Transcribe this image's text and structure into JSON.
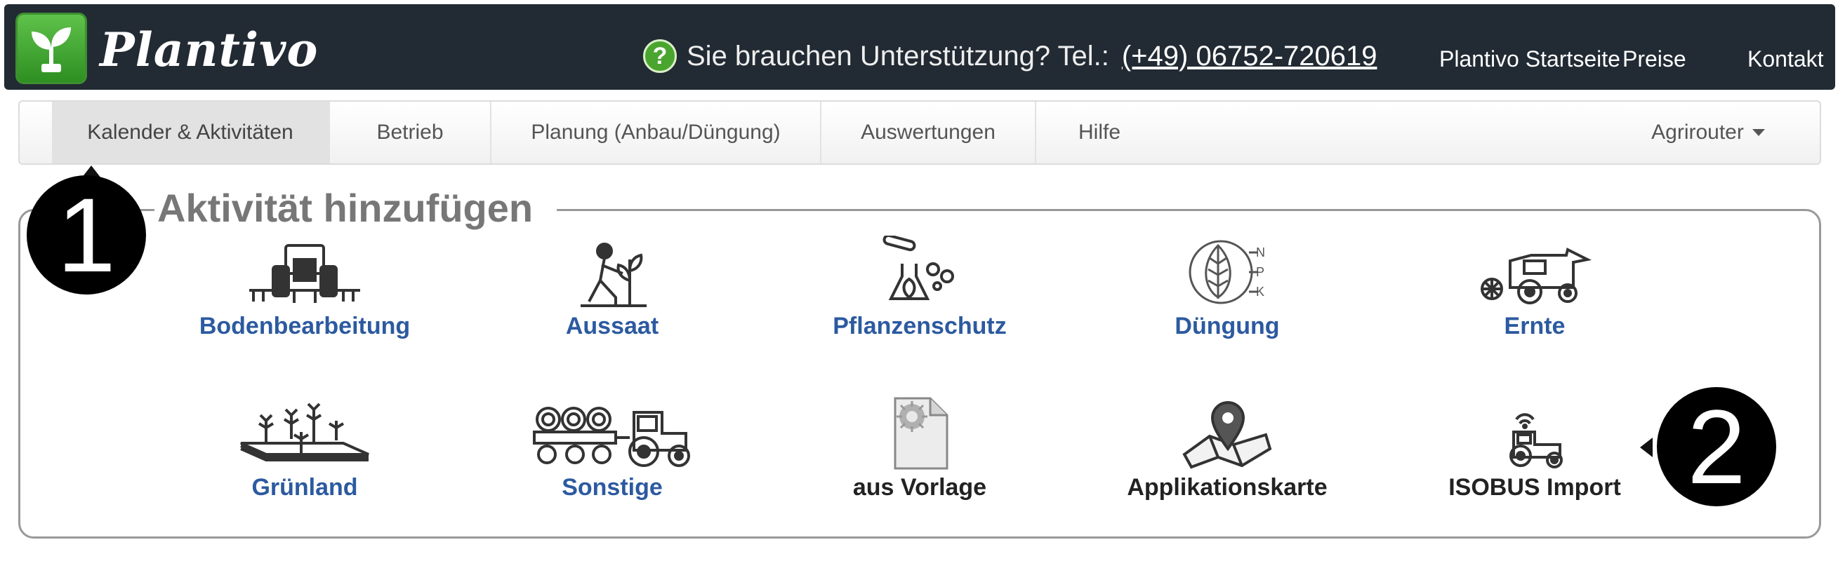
{
  "header": {
    "brand": "Plantivo",
    "support_text": "Sie brauchen Unterstützung? Tel.:",
    "support_phone": "(+49) 06752-720619",
    "links": [
      "Plantivo Startseite",
      "Preise",
      "Kontakt"
    ]
  },
  "tabs": [
    {
      "label": "Kalender & Aktivitäten",
      "active": true
    },
    {
      "label": "Betrieb",
      "active": false
    },
    {
      "label": "Planung (Anbau/Düngung)",
      "active": false
    },
    {
      "label": "Auswertungen",
      "active": false
    },
    {
      "label": "Hilfe",
      "active": false
    },
    {
      "label": "Agrirouter",
      "active": false
    }
  ],
  "panel": {
    "title": "Aktivität hinzufügen",
    "row1": [
      {
        "label": "Bodenbearbeitung",
        "icon": "tractor-cultivator-icon"
      },
      {
        "label": "Aussaat",
        "icon": "farmer-planting-icon"
      },
      {
        "label": "Pflanzenschutz",
        "icon": "lab-flask-icon"
      },
      {
        "label": "Düngung",
        "icon": "npk-leaf-icon"
      },
      {
        "label": "Ernte",
        "icon": "combine-harvester-icon"
      }
    ],
    "row2": [
      {
        "label": "Grünland",
        "icon": "grassland-plants-icon"
      },
      {
        "label": "Sonstige",
        "icon": "tractor-hay-trailer-icon"
      },
      {
        "label": "aus Vorlage",
        "icon": "template-document-icon"
      },
      {
        "label": "Applikationskarte",
        "icon": "map-pin-icon"
      },
      {
        "label": "ISOBUS Import",
        "icon": "wireless-tractor-icon"
      }
    ]
  },
  "callouts": [
    "1",
    "2"
  ],
  "colors": {
    "header_bg": "#222a33",
    "link_blue": "#2c5aa0",
    "help_green": "#4aa52e"
  }
}
